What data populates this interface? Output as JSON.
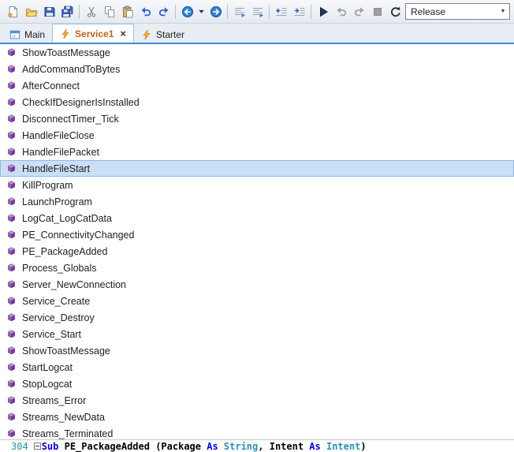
{
  "toolbar": {
    "buttons": [
      {
        "name": "new-file-button",
        "icon": "new-file"
      },
      {
        "name": "open-button",
        "icon": "open-folder"
      },
      {
        "name": "save-button",
        "icon": "save"
      },
      {
        "name": "save-all-button",
        "icon": "save-all"
      },
      {
        "sep": true
      },
      {
        "name": "cut-button",
        "icon": "cut"
      },
      {
        "name": "copy-button",
        "icon": "copy"
      },
      {
        "name": "paste-button",
        "icon": "paste"
      },
      {
        "name": "undo-button",
        "icon": "undo"
      },
      {
        "name": "redo-button",
        "icon": "redo"
      },
      {
        "sep": true
      },
      {
        "name": "navigate-back-button",
        "icon": "back"
      },
      {
        "name": "navigate-back-menu-button",
        "icon": "dropdown",
        "narrow": true
      },
      {
        "name": "navigate-forward-button",
        "icon": "forward"
      },
      {
        "sep": true
      },
      {
        "name": "comment-button",
        "icon": "comment"
      },
      {
        "name": "uncomment-button",
        "icon": "uncomment"
      },
      {
        "sep": true
      },
      {
        "name": "outdent-button",
        "icon": "outdent"
      },
      {
        "name": "indent-button",
        "icon": "indent"
      },
      {
        "sep": true
      },
      {
        "name": "run-button",
        "icon": "run"
      },
      {
        "name": "resume-button",
        "icon": "resume",
        "disabled": true
      },
      {
        "name": "step-button",
        "icon": "step",
        "disabled": true
      },
      {
        "name": "stop-button",
        "icon": "stop",
        "disabled": true
      },
      {
        "name": "restart-button",
        "icon": "restart"
      }
    ],
    "build_config": {
      "value": "Release"
    }
  },
  "close_glyph": "×",
  "tabs": [
    {
      "label": "Main",
      "icon": "activity-module",
      "active": false,
      "closable": false
    },
    {
      "label": "Service1",
      "icon": "service-module",
      "active": true,
      "closable": true
    },
    {
      "label": "Starter",
      "icon": "service-module",
      "active": false,
      "closable": false
    }
  ],
  "member_list": {
    "selected_index": 7,
    "items": [
      "ShowToastMessage",
      "AddCommandToBytes",
      "AfterConnect",
      "CheckIfDesignerIsInstalled",
      "DisconnectTimer_Tick",
      "HandleFileClose",
      "HandleFilePacket",
      "HandleFileStart",
      "KillProgram",
      "LaunchProgram",
      "LogCat_LogCatData",
      "PE_ConnectivityChanged",
      "PE_PackageAdded",
      "Process_Globals",
      "Server_NewConnection",
      "Service_Create",
      "Service_Destroy",
      "Service_Start",
      "ShowToastMessage",
      "StartLogcat",
      "StopLogcat",
      "Streams_Error",
      "Streams_NewData",
      "Streams_Terminated"
    ]
  },
  "code_line": {
    "line_number": "304",
    "tokens": [
      {
        "text": "Sub ",
        "style": "keyword"
      },
      {
        "text": "PE_PackageAdded",
        "style": "name"
      },
      {
        "text": " (Package ",
        "style": "plain"
      },
      {
        "text": "As",
        "style": "keyword"
      },
      {
        "text": " ",
        "style": "plain"
      },
      {
        "text": "String",
        "style": "type"
      },
      {
        "text": ", Intent ",
        "style": "plain"
      },
      {
        "text": "As",
        "style": "keyword"
      },
      {
        "text": " ",
        "style": "plain"
      },
      {
        "text": "Intent",
        "style": "type"
      },
      {
        "text": ")",
        "style": "plain"
      }
    ]
  },
  "colors": {
    "accent_blue": "#3c8be0",
    "selection_bg": "#cbdff4",
    "selection_border": "#8fb8e8",
    "method_icon_purple": "#8e44ad",
    "keyword_blue": "#0000e0",
    "type_teal": "#2b91af",
    "line_number_teal": "#2b91af",
    "active_tab_text_orange": "#c05f1f"
  }
}
